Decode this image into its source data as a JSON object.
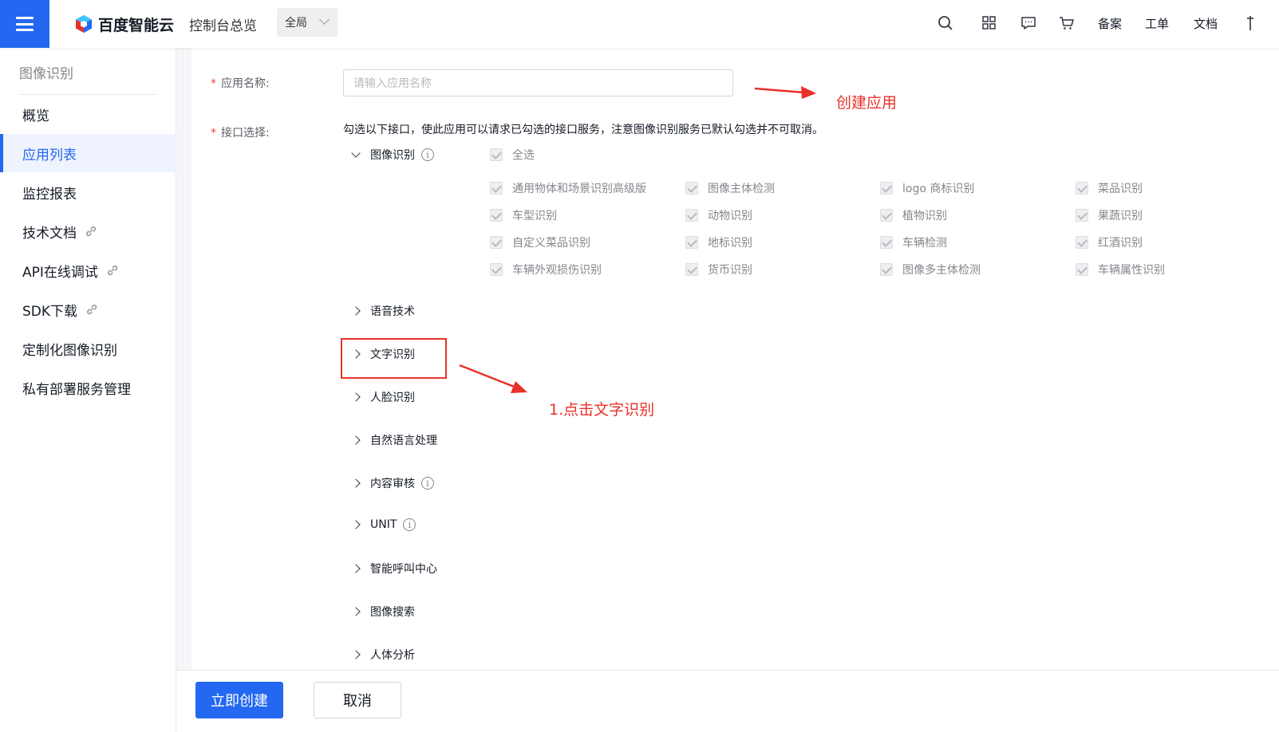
{
  "header": {
    "brand": "百度智能云",
    "console_link": "控制台总览",
    "region": "全局",
    "nav_backup": "备案",
    "nav_ticket": "工单",
    "nav_docs": "文档",
    "accent_color": "#2468f2"
  },
  "sidebar": {
    "title": "图像识别",
    "items": [
      {
        "label": "概览"
      },
      {
        "label": "应用列表"
      },
      {
        "label": "监控报表"
      },
      {
        "label": "技术文档"
      },
      {
        "label": "API在线调试"
      },
      {
        "label": "SDK下载"
      },
      {
        "label": "定制化图像识别"
      },
      {
        "label": "私有部署服务管理"
      }
    ]
  },
  "form": {
    "app_name_label": "应用名称:",
    "app_name_placeholder": "请输入应用名称",
    "interface_label": "接口选择:",
    "hint": "勾选以下接口，使此应用可以请求已勾选的接口服务，注意图像识别服务已默认勾选并不可取消。",
    "required_mark": "*"
  },
  "image_recognition": {
    "label": "图像识别",
    "select_all": "全选",
    "options": [
      [
        "通用物体和场景识别高级版",
        "图像主体检测",
        "logo 商标识别",
        "菜品识别"
      ],
      [
        "车型识别",
        "动物识别",
        "植物识别",
        "果蔬识别"
      ],
      [
        "自定义菜品识别",
        "地标识别",
        "车辆检测",
        "红酒识别"
      ],
      [
        "车辆外观损伤识别",
        "货币识别",
        "图像多主体检测",
        "车辆属性识别"
      ]
    ]
  },
  "categories": [
    {
      "label": "语音技术",
      "info": false
    },
    {
      "label": "文字识别",
      "info": false
    },
    {
      "label": "人脸识别",
      "info": false
    },
    {
      "label": "自然语言处理",
      "info": false
    },
    {
      "label": "内容审核",
      "info": true
    },
    {
      "label": "UNIT",
      "info": true
    },
    {
      "label": "智能呼叫中心",
      "info": false
    },
    {
      "label": "图像搜索",
      "info": false
    },
    {
      "label": "人体分析",
      "info": false
    }
  ],
  "annotations": {
    "create_app": "创建应用",
    "click_ocr": "1.点击文字识别",
    "color": "#e8312a"
  },
  "footer": {
    "create_button": "立即创建",
    "cancel_button": "取消"
  }
}
